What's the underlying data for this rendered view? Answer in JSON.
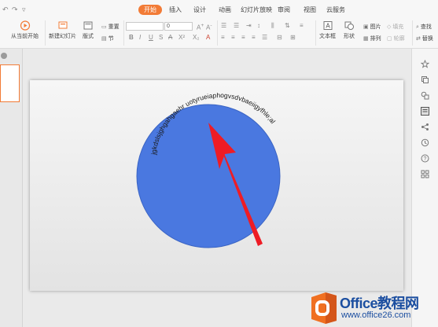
{
  "quick_access": {
    "undo": "↶",
    "redo": "↷",
    "more": "▿"
  },
  "tabs": [
    {
      "label": "开始",
      "active": true
    },
    {
      "label": "插入",
      "active": false
    },
    {
      "label": "设计",
      "active": false
    },
    {
      "label": "动画",
      "active": false
    },
    {
      "label": "幻灯片放映",
      "active": false
    },
    {
      "label": "审阅",
      "active": false
    },
    {
      "label": "视图",
      "active": false
    },
    {
      "label": "云服务",
      "active": false
    }
  ],
  "toolbar": {
    "play_from_current": "从当前开始",
    "new_slide": "新建幻灯片",
    "layout": "版式",
    "reset": "重置",
    "section": "节",
    "font_name": "",
    "font_size": "0",
    "text_box": "文本框",
    "shape": "形状",
    "picture": "图片",
    "arrange": "排列",
    "fill": "填充",
    "outline": "轮廓",
    "find": "查找",
    "replace": "替换"
  },
  "slide": {
    "circle_color": "#4a78e0",
    "arc_text": "jgkdslsjghgahgaehr uotyrueiaphogvsdvbaeiigyfhle;al",
    "arrow_color": "#ee1c25"
  },
  "accent_color": "#f27b36",
  "watermark": {
    "line1": "Office教程网",
    "line2": "www.office26.com"
  }
}
